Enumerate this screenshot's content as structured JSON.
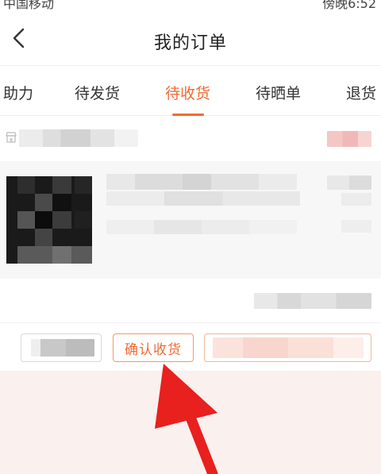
{
  "status_bar": {
    "carrier": "中国移动",
    "time": "傍晚6:52"
  },
  "header": {
    "title": "我的订单"
  },
  "tabs": [
    {
      "label": "助力",
      "active": false
    },
    {
      "label": "待发货",
      "active": false
    },
    {
      "label": "待收货",
      "active": true
    },
    {
      "label": "待晒单",
      "active": false
    },
    {
      "label": "退货",
      "active": false
    }
  ],
  "order": {
    "confirm_button_label": "确认收货"
  },
  "colors": {
    "accent": "#ef6b32",
    "annotation_arrow": "#e8201e"
  },
  "icons": {
    "back": "chevron-left-icon",
    "shop": "store-icon"
  }
}
